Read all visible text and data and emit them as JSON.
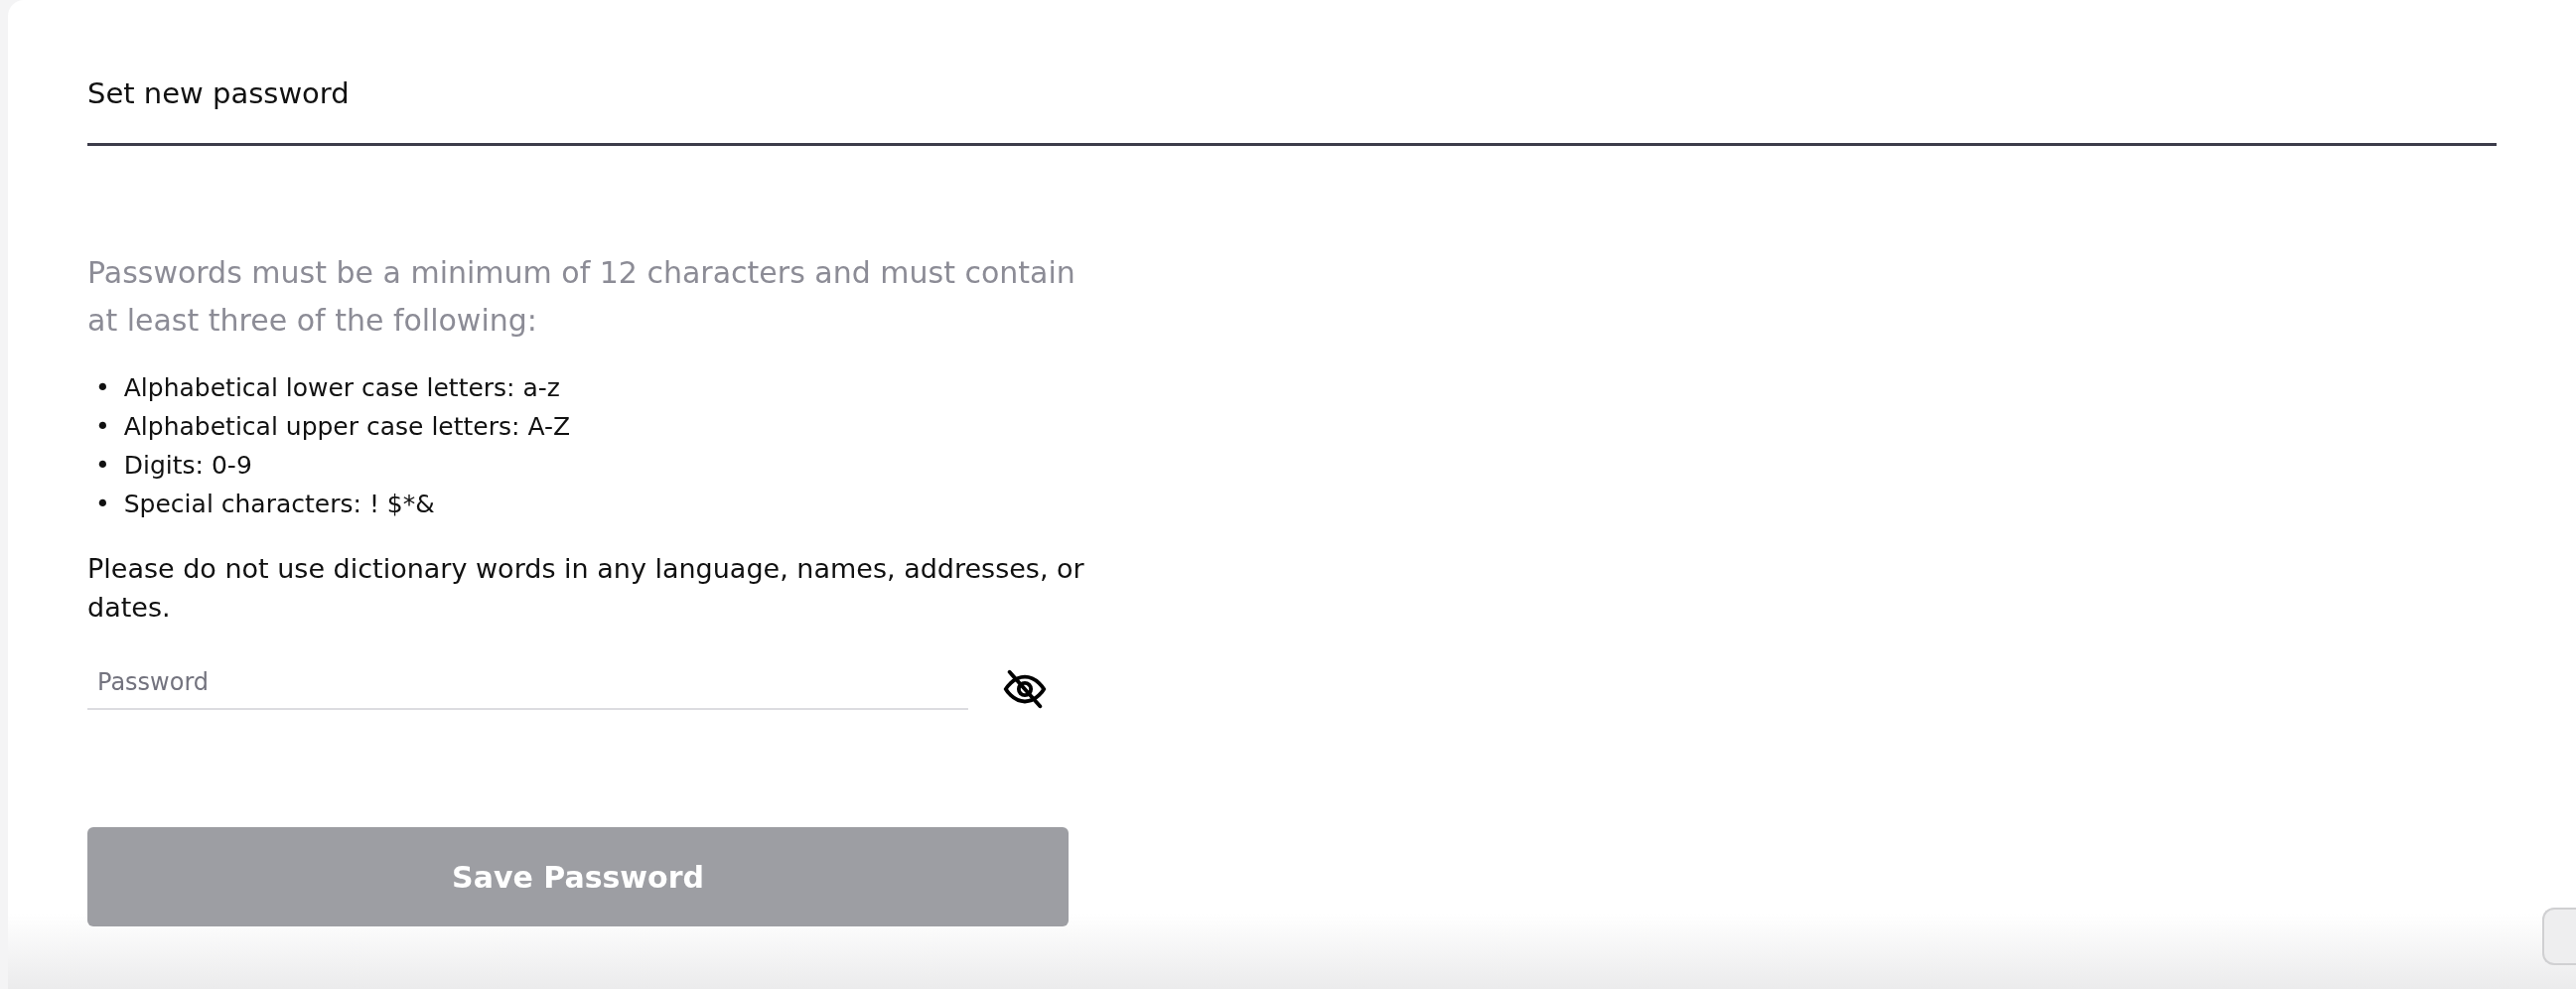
{
  "title": "Set new password",
  "intro": "Passwords must be a minimum of 12 characters and must contain at least three of the following:",
  "requirements": [
    {
      "marker": "•",
      "text": "Alphabetical lower case letters: a-z"
    },
    {
      "marker": "•",
      "text": "Alphabetical upper case letters: A-Z"
    },
    {
      "marker": "•",
      "text": "Digits: 0-9"
    },
    {
      "marker": "•",
      "text": "Special characters: ! $*&"
    }
  ],
  "advice": "Please do not use dictionary words in any language, names, addresses, or dates.",
  "password_field": {
    "placeholder": "Password",
    "visible": false
  },
  "save_button": {
    "label": "Save Password",
    "disabled": true
  }
}
